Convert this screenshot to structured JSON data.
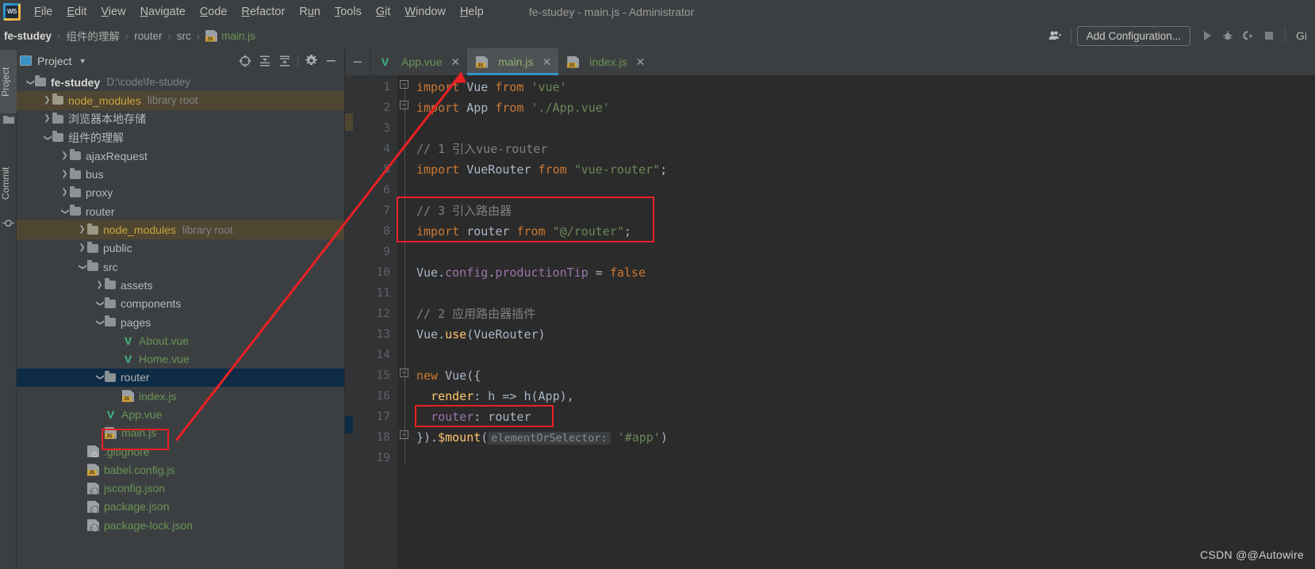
{
  "window": {
    "title": "fe-studey - main.js - Administrator",
    "app_icon": "webstorm-logo-icon"
  },
  "menu": {
    "items": [
      "File",
      "Edit",
      "View",
      "Navigate",
      "Code",
      "Refactor",
      "Run",
      "Tools",
      "Git",
      "Window",
      "Help"
    ]
  },
  "breadcrumb": {
    "items": [
      "fe-studey",
      "组件的理解",
      "router",
      "src",
      "main.js"
    ],
    "separator": "›"
  },
  "toolbar": {
    "add_configuration": "Add Configuration...",
    "git_label": "Gi",
    "icons": [
      "user-accounts-icon",
      "run-icon",
      "debug-icon",
      "coverage-icon",
      "stop-icon"
    ]
  },
  "toolstrip": {
    "project_label": "Project",
    "commit_label": "Commit"
  },
  "project_panel": {
    "title": "Project",
    "actions": [
      "locate-icon",
      "expand-all-icon",
      "collapse-all-icon",
      "settings-icon",
      "hide-icon"
    ],
    "tree": [
      {
        "depth": 0,
        "arrow": "down",
        "icon": "folder",
        "label": "fe-studey",
        "sub": "D:\\code\\fe-studey",
        "style": "root",
        "state": "normal"
      },
      {
        "depth": 1,
        "arrow": "right",
        "icon": "folder-lib",
        "label": "node_modules",
        "sub": "library root",
        "style": "lib",
        "state": "lib-highlight"
      },
      {
        "depth": 1,
        "arrow": "right",
        "icon": "folder",
        "label": "浏览器本地存储",
        "sub": "",
        "style": "normal",
        "state": "normal"
      },
      {
        "depth": 1,
        "arrow": "down",
        "icon": "folder",
        "label": "组件的理解",
        "sub": "",
        "style": "normal",
        "state": "normal"
      },
      {
        "depth": 2,
        "arrow": "right",
        "icon": "folder",
        "label": "ajaxRequest",
        "sub": "",
        "style": "normal",
        "state": "normal"
      },
      {
        "depth": 2,
        "arrow": "right",
        "icon": "folder",
        "label": "bus",
        "sub": "",
        "style": "normal",
        "state": "normal"
      },
      {
        "depth": 2,
        "arrow": "right",
        "icon": "folder",
        "label": "proxy",
        "sub": "",
        "style": "normal",
        "state": "normal"
      },
      {
        "depth": 2,
        "arrow": "down",
        "icon": "folder",
        "label": "router",
        "sub": "",
        "style": "normal",
        "state": "normal"
      },
      {
        "depth": 3,
        "arrow": "right",
        "icon": "folder-lib",
        "label": "node_modules",
        "sub": "library root",
        "style": "lib",
        "state": "lib-highlight"
      },
      {
        "depth": 3,
        "arrow": "right",
        "icon": "folder",
        "label": "public",
        "sub": "",
        "style": "normal",
        "state": "normal"
      },
      {
        "depth": 3,
        "arrow": "down",
        "icon": "folder",
        "label": "src",
        "sub": "",
        "style": "normal",
        "state": "normal"
      },
      {
        "depth": 4,
        "arrow": "right",
        "icon": "folder",
        "label": "assets",
        "sub": "",
        "style": "normal",
        "state": "normal"
      },
      {
        "depth": 4,
        "arrow": "down",
        "icon": "folder",
        "label": "components",
        "sub": "",
        "style": "normal",
        "state": "normal"
      },
      {
        "depth": 4,
        "arrow": "down",
        "icon": "folder",
        "label": "pages",
        "sub": "",
        "style": "normal",
        "state": "normal"
      },
      {
        "depth": 5,
        "arrow": "none",
        "icon": "vue-file",
        "label": "About.vue",
        "sub": "",
        "style": "green",
        "state": "normal"
      },
      {
        "depth": 5,
        "arrow": "none",
        "icon": "vue-file",
        "label": "Home.vue",
        "sub": "",
        "style": "green",
        "state": "normal"
      },
      {
        "depth": 4,
        "arrow": "down",
        "icon": "folder",
        "label": "router",
        "sub": "",
        "style": "normal",
        "state": "selected"
      },
      {
        "depth": 5,
        "arrow": "none",
        "icon": "js-file",
        "label": "index.js",
        "sub": "",
        "style": "green",
        "state": "normal"
      },
      {
        "depth": 4,
        "arrow": "none",
        "icon": "vue-file",
        "label": "App.vue",
        "sub": "",
        "style": "green",
        "state": "normal"
      },
      {
        "depth": 4,
        "arrow": "none",
        "icon": "js-file",
        "label": "main.js",
        "sub": "",
        "style": "green",
        "state": "annotated"
      },
      {
        "depth": 3,
        "arrow": "none",
        "icon": "ignore-file",
        "label": ".gitignore",
        "sub": "",
        "style": "green",
        "state": "normal"
      },
      {
        "depth": 3,
        "arrow": "none",
        "icon": "js-file",
        "label": "babel.config.js",
        "sub": "",
        "style": "green",
        "state": "normal"
      },
      {
        "depth": 3,
        "arrow": "none",
        "icon": "json-file",
        "label": "jsconfig.json",
        "sub": "",
        "style": "green",
        "state": "normal"
      },
      {
        "depth": 3,
        "arrow": "none",
        "icon": "json-file",
        "label": "package.json",
        "sub": "",
        "style": "green",
        "state": "normal"
      },
      {
        "depth": 3,
        "arrow": "none",
        "icon": "json-file",
        "label": "package-lock.json",
        "sub": "",
        "style": "green",
        "state": "normal"
      }
    ]
  },
  "editor": {
    "tabs": [
      {
        "label": "App.vue",
        "icon": "vue-file-icon",
        "active": false
      },
      {
        "label": "main.js",
        "icon": "js-file-icon",
        "active": true
      },
      {
        "label": "index.js",
        "icon": "js-file-icon",
        "active": false
      }
    ],
    "close_glyph": "✕",
    "line_numbers": [
      "1",
      "2",
      "3",
      "4",
      "5",
      "6",
      "7",
      "8",
      "9",
      "10",
      "11",
      "12",
      "13",
      "14",
      "15",
      "16",
      "17",
      "18",
      "19"
    ],
    "lines": [
      {
        "n": 1,
        "tokens": [
          {
            "t": "import",
            "c": "kw"
          },
          {
            "t": " ",
            "c": "dot"
          },
          {
            "t": "Vue",
            "c": "id"
          },
          {
            "t": " ",
            "c": "dot"
          },
          {
            "t": "from",
            "c": "kw"
          },
          {
            "t": " ",
            "c": "dot"
          },
          {
            "t": "'vue'",
            "c": "str"
          }
        ]
      },
      {
        "n": 2,
        "tokens": [
          {
            "t": "import",
            "c": "kw"
          },
          {
            "t": " ",
            "c": "dot"
          },
          {
            "t": "App",
            "c": "id"
          },
          {
            "t": " ",
            "c": "dot"
          },
          {
            "t": "from",
            "c": "kw"
          },
          {
            "t": " ",
            "c": "dot"
          },
          {
            "t": "'./App.vue'",
            "c": "str"
          }
        ]
      },
      {
        "n": 3,
        "tokens": []
      },
      {
        "n": 4,
        "tokens": [
          {
            "t": "// 1 引入vue-router",
            "c": "cmt"
          }
        ]
      },
      {
        "n": 5,
        "tokens": [
          {
            "t": "import",
            "c": "kw"
          },
          {
            "t": " ",
            "c": "dot"
          },
          {
            "t": "VueRouter",
            "c": "id"
          },
          {
            "t": " ",
            "c": "dot"
          },
          {
            "t": "from",
            "c": "kw"
          },
          {
            "t": " ",
            "c": "dot"
          },
          {
            "t": "\"vue-router\"",
            "c": "str"
          },
          {
            "t": ";",
            "c": "pun"
          }
        ]
      },
      {
        "n": 6,
        "tokens": []
      },
      {
        "n": 7,
        "tokens": [
          {
            "t": "// 3 引入路由器",
            "c": "cmt"
          }
        ]
      },
      {
        "n": 8,
        "tokens": [
          {
            "t": "import",
            "c": "kw"
          },
          {
            "t": " ",
            "c": "dot"
          },
          {
            "t": "router",
            "c": "id"
          },
          {
            "t": " ",
            "c": "dot"
          },
          {
            "t": "from",
            "c": "kw"
          },
          {
            "t": " ",
            "c": "dot"
          },
          {
            "t": "\"@/router\"",
            "c": "str"
          },
          {
            "t": ";",
            "c": "pun"
          }
        ]
      },
      {
        "n": 9,
        "tokens": []
      },
      {
        "n": 10,
        "tokens": [
          {
            "t": "Vue",
            "c": "id"
          },
          {
            "t": ".",
            "c": "pun"
          },
          {
            "t": "config",
            "c": "fld"
          },
          {
            "t": ".",
            "c": "pun"
          },
          {
            "t": "productionTip",
            "c": "fld"
          },
          {
            "t": " = ",
            "c": "pun"
          },
          {
            "t": "false",
            "c": "kw"
          }
        ]
      },
      {
        "n": 11,
        "tokens": []
      },
      {
        "n": 12,
        "tokens": [
          {
            "t": "// 2 应用路由器插件",
            "c": "cmt"
          }
        ]
      },
      {
        "n": 13,
        "tokens": [
          {
            "t": "Vue",
            "c": "id"
          },
          {
            "t": ".",
            "c": "pun"
          },
          {
            "t": "use",
            "c": "fn"
          },
          {
            "t": "(VueRouter)",
            "c": "id"
          }
        ]
      },
      {
        "n": 14,
        "tokens": []
      },
      {
        "n": 15,
        "tokens": [
          {
            "t": "new",
            "c": "kw"
          },
          {
            "t": " ",
            "c": "dot"
          },
          {
            "t": "Vue({",
            "c": "id"
          }
        ]
      },
      {
        "n": 16,
        "tokens": [
          {
            "t": "  ",
            "c": "dot"
          },
          {
            "t": "render",
            "c": "fn"
          },
          {
            "t": ": h => h(App),",
            "c": "id"
          }
        ]
      },
      {
        "n": 17,
        "tokens": [
          {
            "t": "  ",
            "c": "dot"
          },
          {
            "t": "router",
            "c": "fld"
          },
          {
            "t": ": router",
            "c": "id"
          }
        ]
      },
      {
        "n": 18,
        "tokens": [
          {
            "t": "}).",
            "c": "id"
          },
          {
            "t": "$mount",
            "c": "fn"
          },
          {
            "t": "(",
            "c": "id"
          },
          {
            "t": "elementOrSelector:",
            "c": "hint"
          },
          {
            "t": " ",
            "c": "dot"
          },
          {
            "t": "'#app'",
            "c": "str"
          },
          {
            "t": ")",
            "c": "id"
          }
        ]
      },
      {
        "n": 19,
        "tokens": []
      }
    ],
    "annotations": [
      {
        "name": "import-router-highlight",
        "label": "red box around lines 7-8"
      },
      {
        "name": "router-option-highlight",
        "label": "red box around line 17 router: router"
      },
      {
        "name": "main-js-file-highlight",
        "label": "red box around main.js in tree"
      },
      {
        "name": "pointer-arrow",
        "label": "red arrow from main.js file to main.js tab"
      }
    ]
  },
  "watermark": "CSDN @@Autowire"
}
